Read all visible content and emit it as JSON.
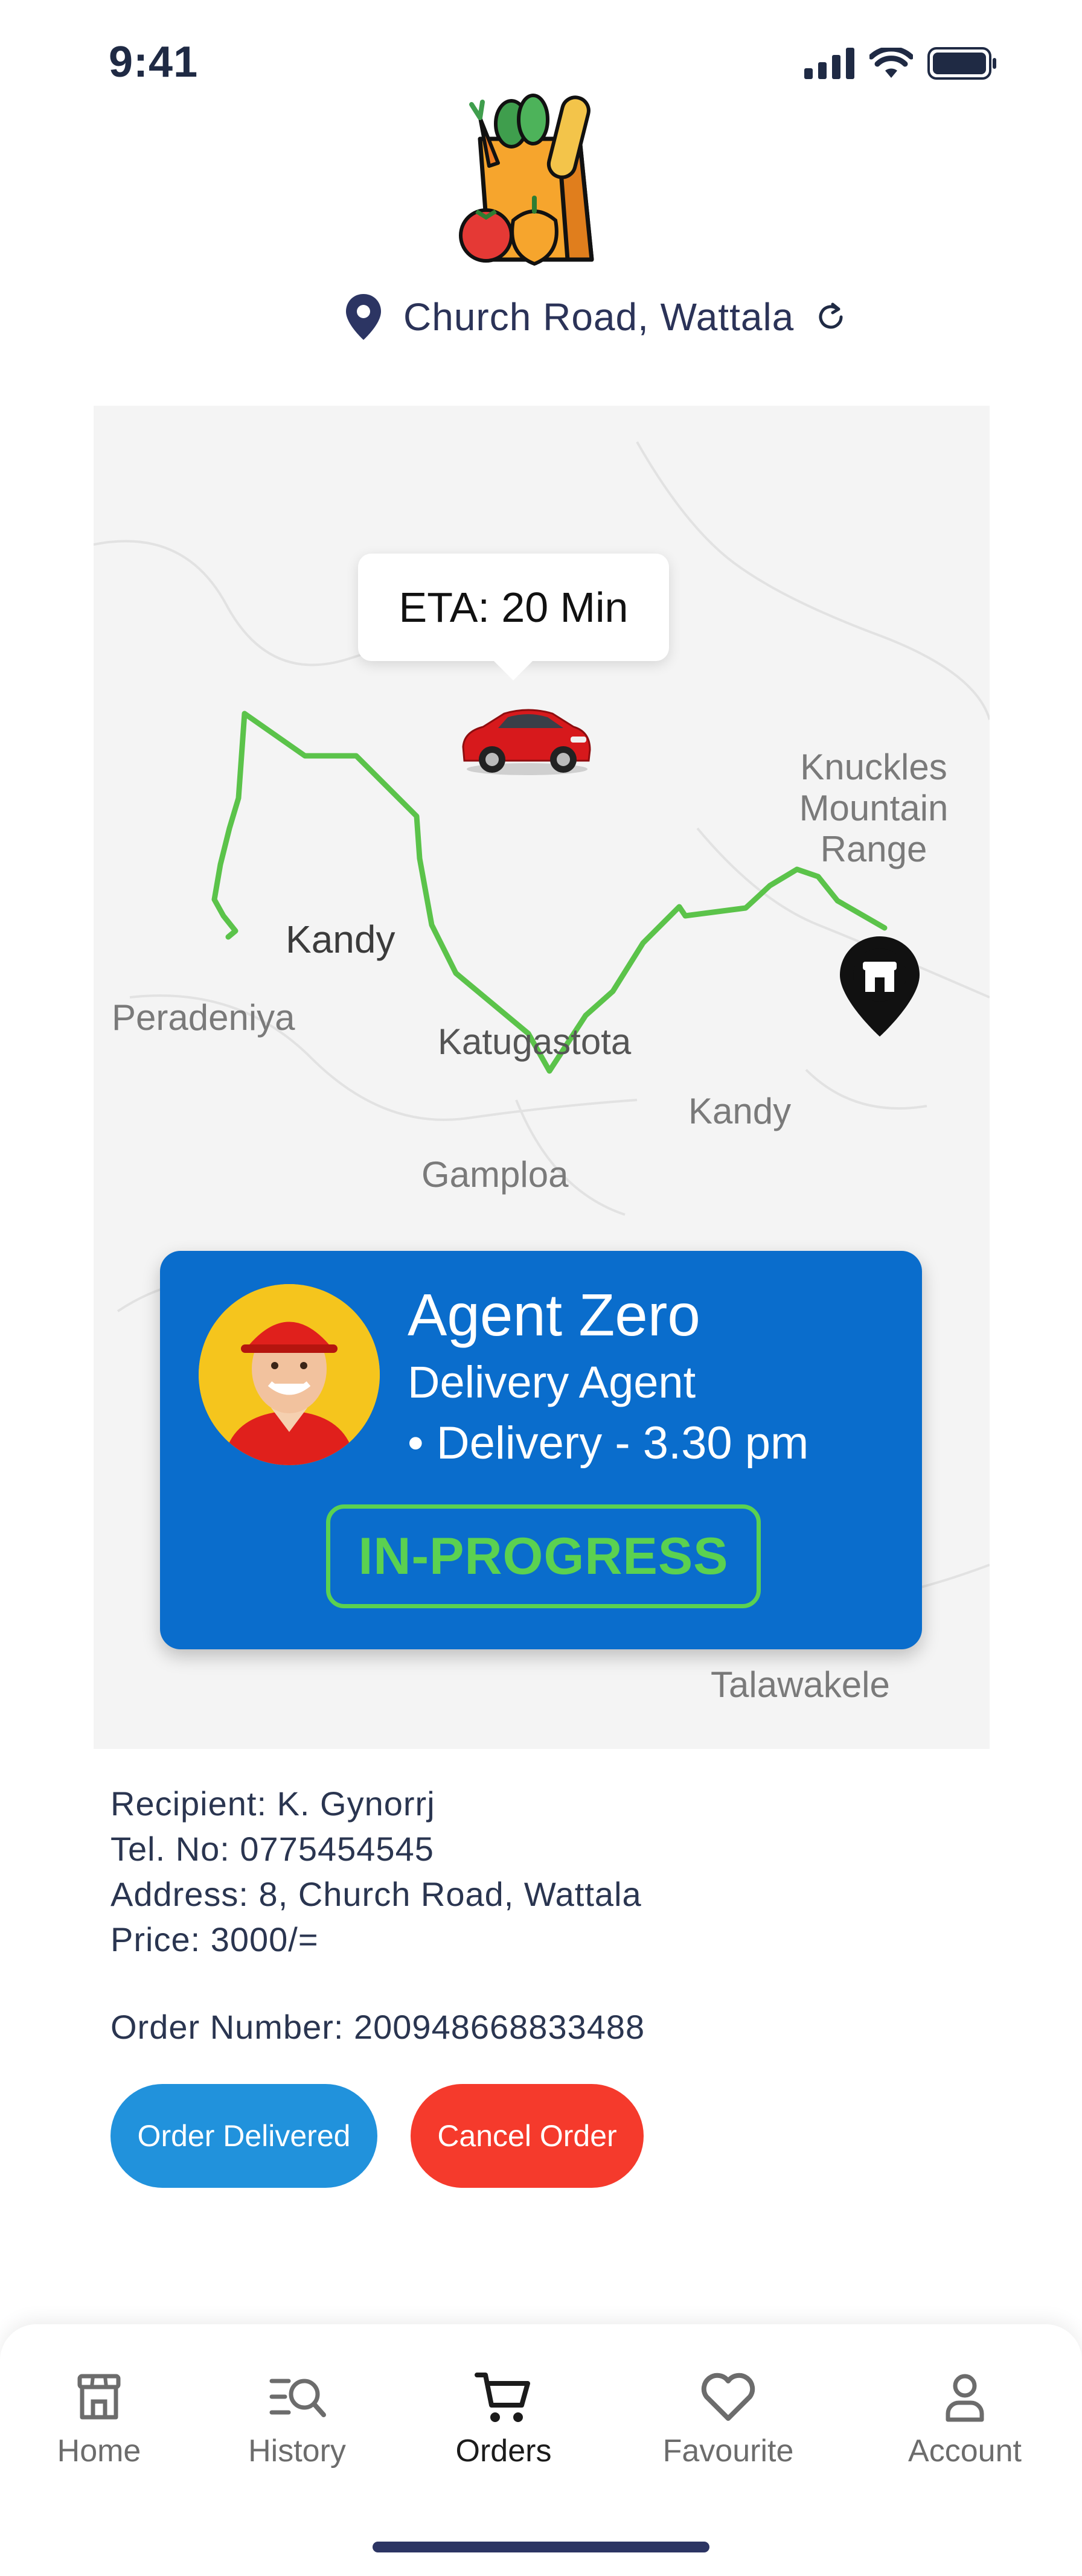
{
  "status_bar": {
    "time": "9:41"
  },
  "header": {
    "location": "Church Road, Wattala"
  },
  "map": {
    "eta": "ETA: 20 Min",
    "labels": {
      "knuckles_1": "Knuckles",
      "knuckles_2": "Mountain",
      "knuckles_3": "Range",
      "kandy_main": "Kandy",
      "peradeniya": "Peradeniya",
      "katugastota": "Katugastota",
      "kandy_east": "Kandy",
      "gamploa": "Gamploa",
      "talawakele": "Talawakele"
    },
    "route_color": "#5bc34a"
  },
  "agent": {
    "name": "Agent Zero",
    "role": "Delivery Agent",
    "delivery": "• Delivery - 3.30 pm",
    "status": "IN-PROGRESS",
    "status_color": "#5bd150",
    "card_color": "#0a6dcc"
  },
  "order": {
    "recipient": "Recipient: K. Gynorrj",
    "tel": "Tel. No: 0775454545",
    "address": "Address: 8, Church Road, Wattala",
    "price": "Price: 3000/=",
    "order_number": "Order Number: 200948668833488"
  },
  "actions": {
    "delivered_label": "Order Delivered",
    "cancel_label": "Cancel Order"
  },
  "nav": {
    "items": [
      {
        "label": "Home",
        "icon": "store-icon"
      },
      {
        "label": "History",
        "icon": "history-search-icon"
      },
      {
        "label": "Orders",
        "icon": "cart-icon",
        "active": true
      },
      {
        "label": "Favourite",
        "icon": "heart-icon"
      },
      {
        "label": "Account",
        "icon": "user-icon"
      }
    ]
  }
}
